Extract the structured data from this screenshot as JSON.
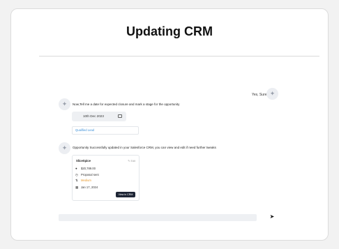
{
  "title": "Updating CRM",
  "chat": {
    "user_reply": "Yes, Sure",
    "assistant_prompt": "Now,Tell me a date for expected closure and mark a stage for the opportunity",
    "date_value": "10th Dec 2023",
    "stage_value": "Qualified Lead",
    "confirmation": "Opportunity Successfully updated in your Salesforce CRM, you can view and edit if need further tweaks"
  },
  "opportunity": {
    "name": "SliceSpice",
    "edit_label": "Edit",
    "amount": "$20,789.00",
    "status": "Proposal sent",
    "priority": "Medium",
    "date": "Jan 17, 2024",
    "button_label": "View in CRM"
  },
  "input": {
    "placeholder": "",
    "send_icon": "send-arrow-icon"
  },
  "colors": {
    "accent_link": "#3a8fd8",
    "priority": "#e89a2c",
    "button_bg": "#1e2535"
  }
}
